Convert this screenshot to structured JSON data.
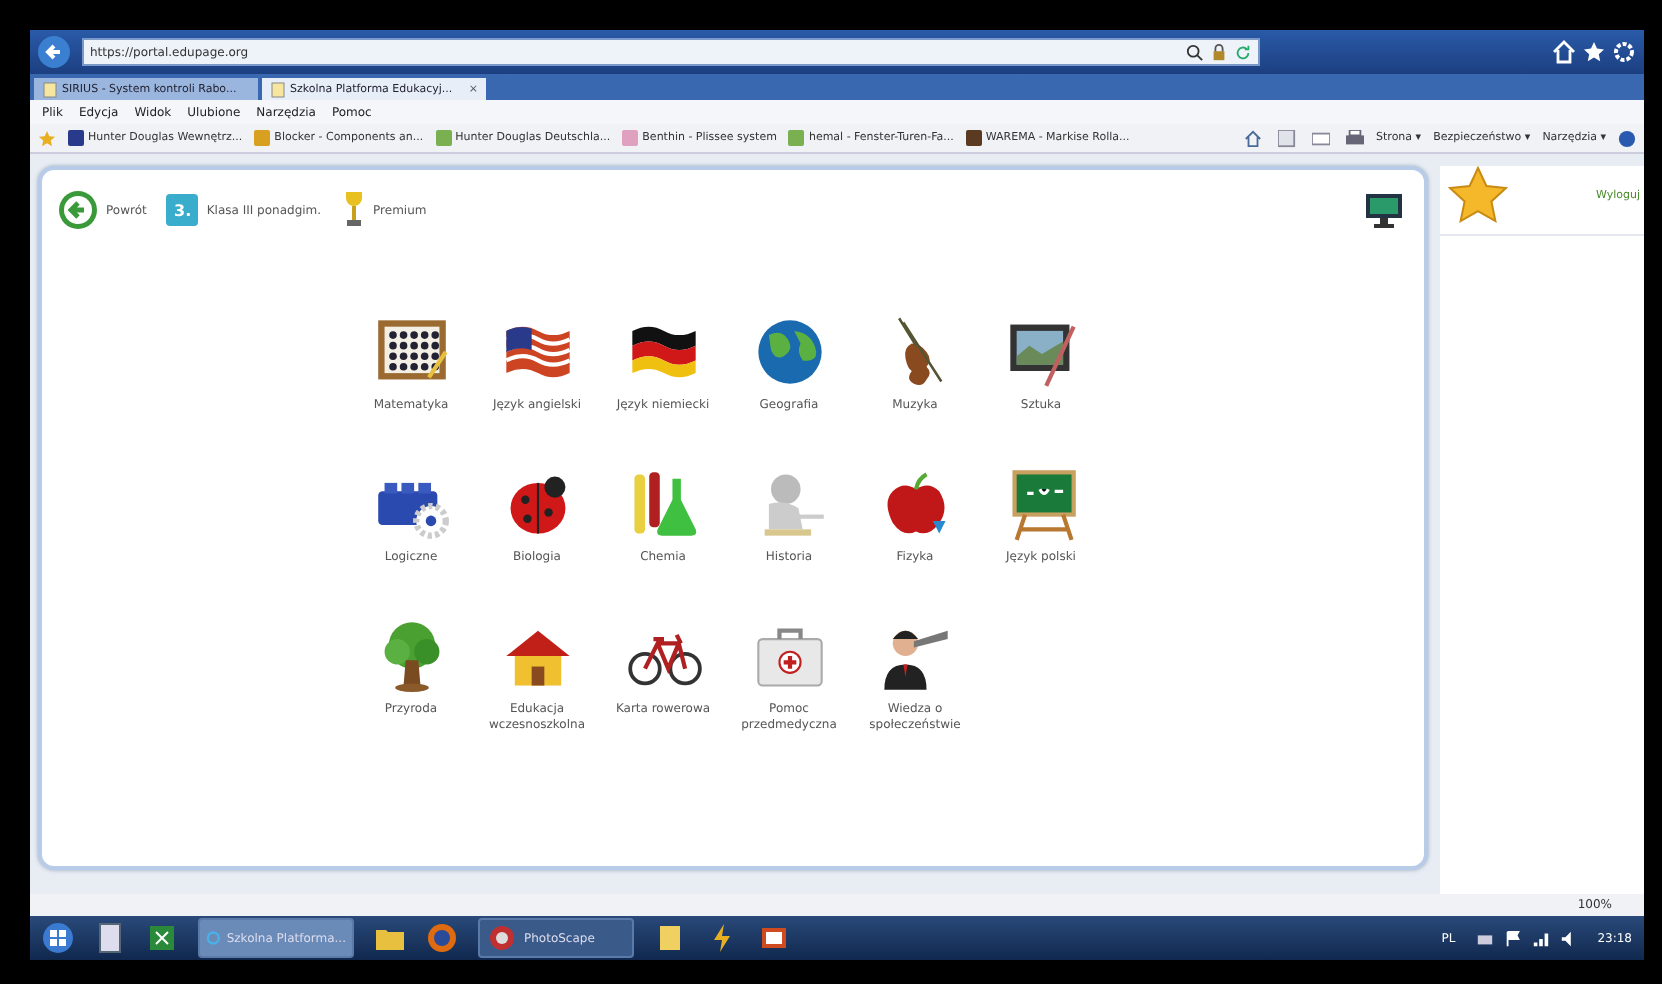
{
  "browser": {
    "address": "https://portal.edupage.org",
    "tabs": [
      {
        "label": "SIRIUS - System kontroli Rabo...",
        "selected": false
      },
      {
        "label": "Szkolna Platforma Edukacyj...",
        "selected": true,
        "close": "×"
      }
    ],
    "menu": [
      "Plik",
      "Edycja",
      "Widok",
      "Ulubione",
      "Narzędzia",
      "Pomoc"
    ],
    "favorites": [
      "Hunter Douglas Wewnętrz...",
      "Blocker - Components an...",
      "Hunter Douglas Deutschla...",
      "Benthin - Plissee system",
      "hemal - Fenster-Turen-Fa...",
      "WAREMA - Markise Rolla..."
    ],
    "commands": [
      "Strona ▾",
      "Bezpieczeństwo ▾",
      "Narzędzia ▾"
    ]
  },
  "page": {
    "back": "Powrót",
    "class_badge": "3.",
    "class_name": "Klasa III ponadgim.",
    "premium": "Premium",
    "logout": "Wyloguj",
    "subjects": [
      {
        "label": "Matematyka"
      },
      {
        "label": "Język angielski"
      },
      {
        "label": "Język niemiecki"
      },
      {
        "label": "Geografia"
      },
      {
        "label": "Muzyka"
      },
      {
        "label": "Sztuka"
      },
      {
        "label": "Logiczne"
      },
      {
        "label": "Biologia"
      },
      {
        "label": "Chemia"
      },
      {
        "label": "Historia"
      },
      {
        "label": "Fizyka"
      },
      {
        "label": "Język polski"
      },
      {
        "label": "Przyroda"
      },
      {
        "label": "Edukacja wczesnoszkolna"
      },
      {
        "label": "Karta rowerowa"
      },
      {
        "label": "Pomoc przedmedyczna"
      },
      {
        "label": "Wiedza o społeczeństwie"
      }
    ]
  },
  "status_bar": {
    "zoom": "100%"
  },
  "taskbar": {
    "windows": [
      {
        "label": "Szkolna Platforma...",
        "selected": true
      },
      {
        "label": "PhotoScape",
        "selected": false
      }
    ],
    "language": "PL",
    "clock": "23:18"
  }
}
